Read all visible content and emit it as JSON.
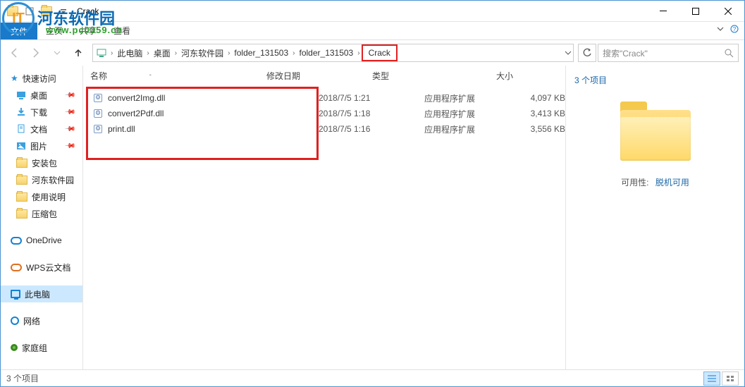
{
  "window": {
    "title": "Crack"
  },
  "watermark": {
    "name": "河东软件园",
    "url": "www.pc0359.cn",
    "logo": "IT"
  },
  "ribbon": {
    "file": "文件",
    "home": "主页",
    "share": "共享",
    "view": "查看"
  },
  "nav": {
    "segments": [
      "此电脑",
      "桌面",
      "河东软件园",
      "folder_131503",
      "folder_131503",
      "Crack"
    ],
    "search_placeholder": "搜索\"Crack\""
  },
  "sidebar": {
    "quick": {
      "label": "快速访问",
      "items": [
        "桌面",
        "下载",
        "文档",
        "图片",
        "安装包",
        "河东软件园",
        "使用说明",
        "压缩包"
      ]
    },
    "onedrive": "OneDrive",
    "wps": "WPS云文档",
    "thispc": "此电脑",
    "network": "网络",
    "homegroup": "家庭组"
  },
  "columns": {
    "name": "名称",
    "date": "修改日期",
    "type": "类型",
    "size": "大小"
  },
  "files": [
    {
      "name": "convert2Img.dll",
      "date": "2018/7/5 1:21",
      "type": "应用程序扩展",
      "size": "4,097 KB"
    },
    {
      "name": "convert2Pdf.dll",
      "date": "2018/7/5 1:18",
      "type": "应用程序扩展",
      "size": "3,413 KB"
    },
    {
      "name": "print.dll",
      "date": "2018/7/5 1:16",
      "type": "应用程序扩展",
      "size": "3,556 KB"
    }
  ],
  "details": {
    "count": "3 个项目",
    "avail_label": "可用性:",
    "avail_value": "脱机可用"
  },
  "status": {
    "text": "3 个项目"
  }
}
